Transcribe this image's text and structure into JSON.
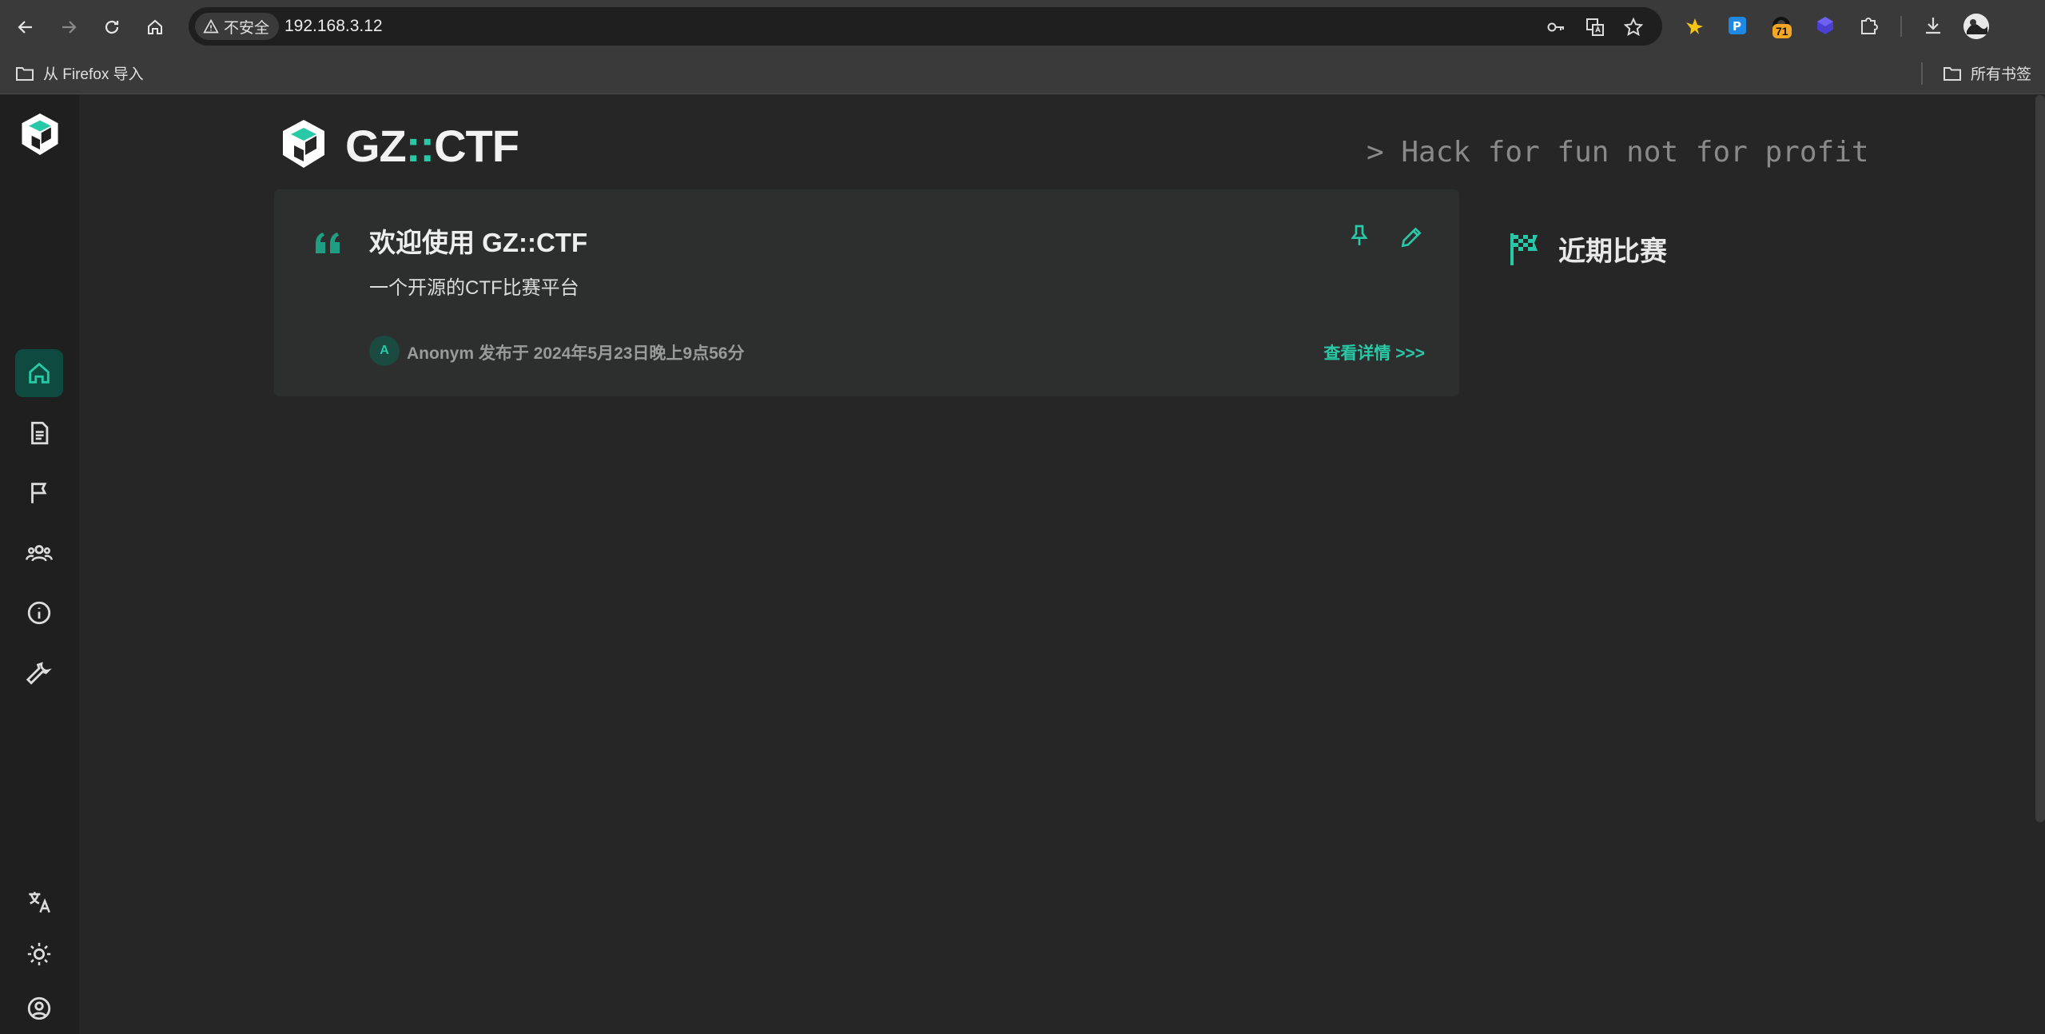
{
  "browser": {
    "security_label": "不安全",
    "url": "192.168.3.12",
    "extension_badge": "71",
    "bookmarks": {
      "import_label": "从 Firefox 导入",
      "all_bookmarks_label": "所有书签"
    }
  },
  "app": {
    "brand": {
      "name_prefix": "GZ",
      "name_separator": "::",
      "name_suffix": "CTF"
    },
    "slogan": "> Hack for fun not for profit",
    "sidebar": {
      "items": [
        "home-icon",
        "posts-icon",
        "games-icon",
        "teams-icon",
        "about-icon",
        "admin-icon"
      ],
      "bottom_items": [
        "translate-icon",
        "theme-icon",
        "account-icon"
      ],
      "active_item": "home-icon"
    },
    "post": {
      "title": "欢迎使用 GZ::CTF",
      "summary": "一个开源的CTF比赛平台",
      "author_initial": "A",
      "meta": "Anonym 发布于 2024年5月23日晚上9点56分",
      "read_more": "查看详情 >>>"
    },
    "recent": {
      "title": "近期比赛"
    }
  },
  "colors": {
    "accent": "#27c9a6",
    "background": "#262626",
    "sidebar": "#1f1f1f",
    "card": "#2d2f2f"
  }
}
